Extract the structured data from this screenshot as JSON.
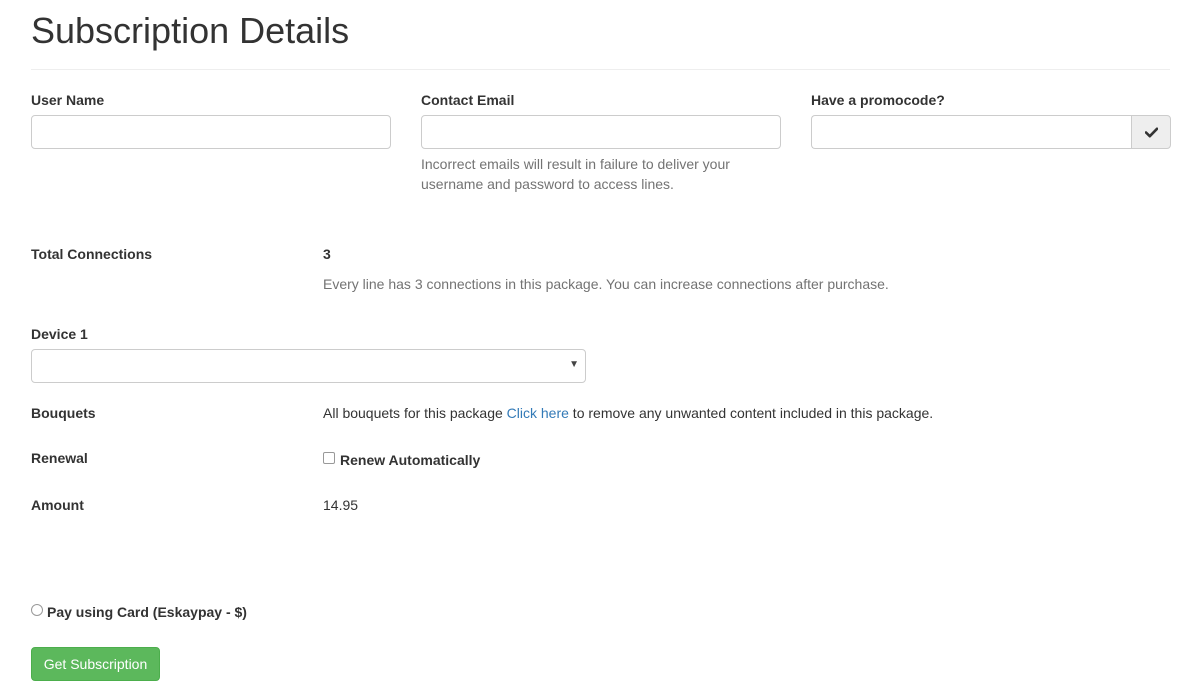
{
  "page": {
    "title": "Subscription Details"
  },
  "form": {
    "username": {
      "label": "User Name",
      "value": "",
      "placeholder": ""
    },
    "email": {
      "label": "Contact Email",
      "value": "",
      "placeholder": "",
      "help_line1": "Incorrect emails will result in failure to deliver your",
      "help_line2": "username and password to access lines."
    },
    "promocode": {
      "label": "Have a promocode?",
      "value": "",
      "placeholder": "",
      "button_icon": "check-icon"
    }
  },
  "connections": {
    "label": "Total Connections",
    "value": "3",
    "help": "Every line has 3 connections in this package. You can increase connections after purchase."
  },
  "device": {
    "label": "Device 1",
    "selected": ""
  },
  "bouquets": {
    "label": "Bouquets",
    "text_before": "All bouquets for this package ",
    "link_text": "Click here",
    "text_after": " to remove any unwanted content included in this package."
  },
  "renewal": {
    "label": "Renewal",
    "checkbox_label": "Renew Automatically",
    "checked": false
  },
  "amount": {
    "label": "Amount",
    "value": "14.95"
  },
  "payment": {
    "option_label": "Pay using Card (Eskaypay - $)",
    "selected": false
  },
  "submit": {
    "label": "Get Subscription"
  },
  "colors": {
    "link": "#337ab7",
    "success": "#5cb85c",
    "text": "#333333",
    "help": "#737373"
  }
}
